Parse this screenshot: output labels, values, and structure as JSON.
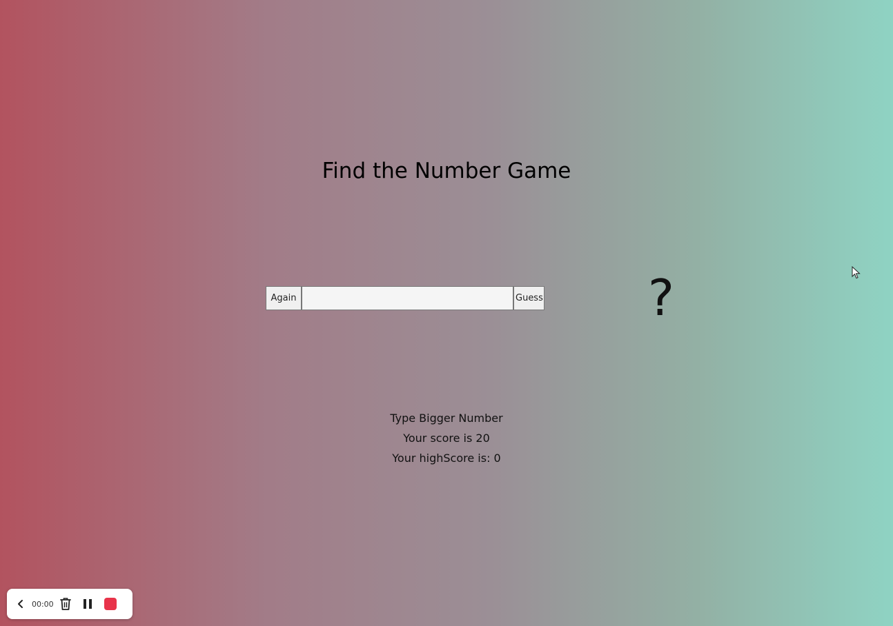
{
  "game": {
    "title": "Find the Number Game",
    "again_label": "Again",
    "guess_label": "Guess",
    "guess_input_value": "",
    "guess_input_placeholder": "",
    "secret_number": "?",
    "message": "Type Bigger Number",
    "score_text": "Your score is 20",
    "highscore_text": "Your highScore is: 0"
  },
  "recorder": {
    "time": "00:00",
    "icons": [
      "chevron-left-icon",
      "trash-icon",
      "pause-icon",
      "stop-icon"
    ],
    "stop_color": "#e8334a"
  },
  "colors": {
    "gradient_left": "#b2535f",
    "gradient_right": "#8fd3c3"
  }
}
